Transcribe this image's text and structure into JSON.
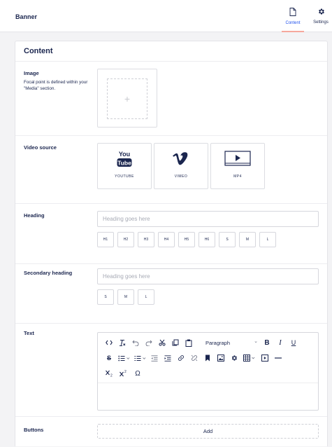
{
  "header": {
    "title": "Banner",
    "tabs": [
      {
        "label": "Content",
        "icon": "file-icon",
        "active": true
      },
      {
        "label": "Settings",
        "icon": "gear-icon",
        "active": false
      }
    ]
  },
  "panel": {
    "title": "Content",
    "image": {
      "label": "Image",
      "help": "Focal point is defined within your \"Media\" section."
    },
    "video": {
      "label": "Video source",
      "options": [
        "YOUTUBE",
        "VIMEO",
        "MP4"
      ],
      "youtube_logo": [
        "You",
        "Tube"
      ]
    },
    "heading": {
      "label": "Heading",
      "placeholder": "Heading goes here",
      "sizes": [
        "H1",
        "H2",
        "H3",
        "H4",
        "H5",
        "H6",
        "S",
        "M",
        "L"
      ]
    },
    "secondary_heading": {
      "label": "Secondary heading",
      "placeholder": "Heading goes here",
      "sizes": [
        "S",
        "M",
        "L"
      ]
    },
    "text": {
      "label": "Text",
      "format_select": "Paragraph"
    },
    "buttons": {
      "label": "Buttons",
      "add_label": "Add"
    }
  },
  "colors": {
    "accent_underline": "#f6a89d",
    "text": "#1b264f",
    "border": "#d6d7dd",
    "placeholder": "#a8abb6"
  }
}
